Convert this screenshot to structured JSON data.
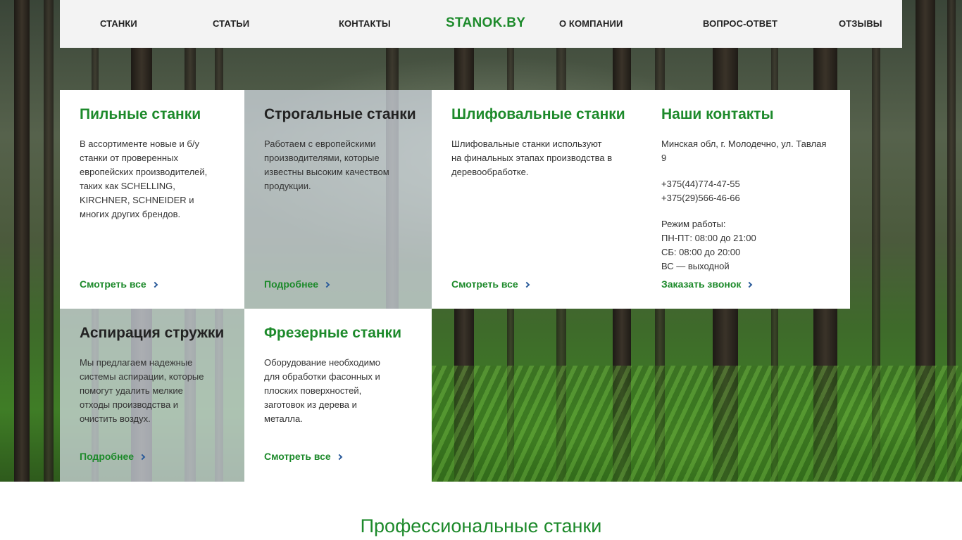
{
  "nav": {
    "items": [
      "СТАНКИ",
      "СТАТЬИ",
      "КОНТАКТЫ",
      "О КОМПАНИИ",
      "ВОПРОС-ОТВЕТ",
      "ОТЗЫВЫ"
    ],
    "logo": "STANOK.BY"
  },
  "tiles": {
    "saw": {
      "title": "Пильные станки",
      "text": "В ассортименте новые и б/у станки от проверенных европейских производителей, таких как SCHELLING, KIRCHNER, SCHNEIDER и многих других брендов.",
      "link": "Смотреть все"
    },
    "planer": {
      "title": "Строгальные станки",
      "text": "Работаем с европейскими производителями, которые известны высоким качеством продукции.",
      "link": "Подробнее"
    },
    "grinder": {
      "title": "Шлифовальные станки",
      "text": "Шлифовальные станки используют на финальных этапах производства в деревообработке.",
      "link": "Смотреть все"
    },
    "contacts": {
      "title": "Наши контакты",
      "address": "Минская обл, г. Молодечно, ул. Тавлая 9",
      "phone1": "+375(44)774-47-55",
      "phone2": "+375(29)566-46-66",
      "hours_title": "Режим работы:",
      "hours_weekdays": "ПН-ПТ: 08:00 до 21:00",
      "hours_sat": "СБ: 08:00 до 20:00",
      "hours_sun": "ВС — выходной",
      "link": "Заказать звонок"
    },
    "aspiration": {
      "title": "Аспирация стружки",
      "text": "Мы предлагаем надежные системы аспирации, которые помогут удалить мелкие отходы производства и очистить воздух.",
      "link": "Подробнее"
    },
    "milling": {
      "title": "Фрезерные станки",
      "text": "Оборудование необходимо для обработки фасонных и плоских поверхностей, заготовок из дерева и металла.",
      "link": "Смотреть все"
    }
  },
  "section_title": "Профессиональные станки",
  "colors": {
    "brand_green": "#1d8a2b",
    "chevron_blue": "#2a5a9a"
  },
  "icons": {
    "link_arrow": "chevron-right-icon"
  }
}
